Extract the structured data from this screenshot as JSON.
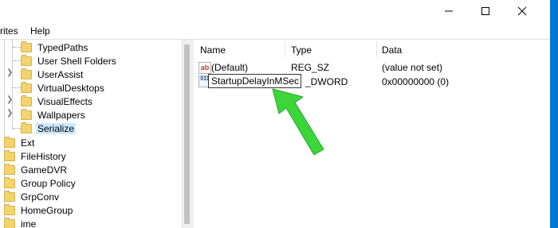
{
  "menu": {
    "favorites": "rites",
    "help": "Help"
  },
  "tree": {
    "sub_items": [
      "TypedPaths",
      "User Shell Folders",
      "UserAssist",
      "VirtualDesktops",
      "VisualEffects",
      "Wallpapers",
      "Serialize"
    ],
    "root_items": [
      "Ext",
      "FileHistory",
      "GameDVR",
      "Group Policy",
      "GrpConv",
      "HomeGroup",
      "ime"
    ],
    "selected": "Serialize"
  },
  "columns": {
    "name": "Name",
    "type": "Type",
    "data": "Data"
  },
  "values": [
    {
      "name": "(Default)",
      "type": "REG_SZ",
      "data": "(value not set)",
      "icon": "string-value-icon"
    },
    {
      "name": "StartupDelayInMSec",
      "type_partial": "_DWORD",
      "data": "0x00000000 (0)",
      "icon": "binary-value-icon"
    }
  ],
  "rename_text": "StartupDelayInMSec",
  "icons": {
    "string": "ab",
    "binary": "011"
  },
  "colors": {
    "accent": "#0078d7",
    "arrow": "#3ad63a",
    "selection": "#cce8ff"
  }
}
